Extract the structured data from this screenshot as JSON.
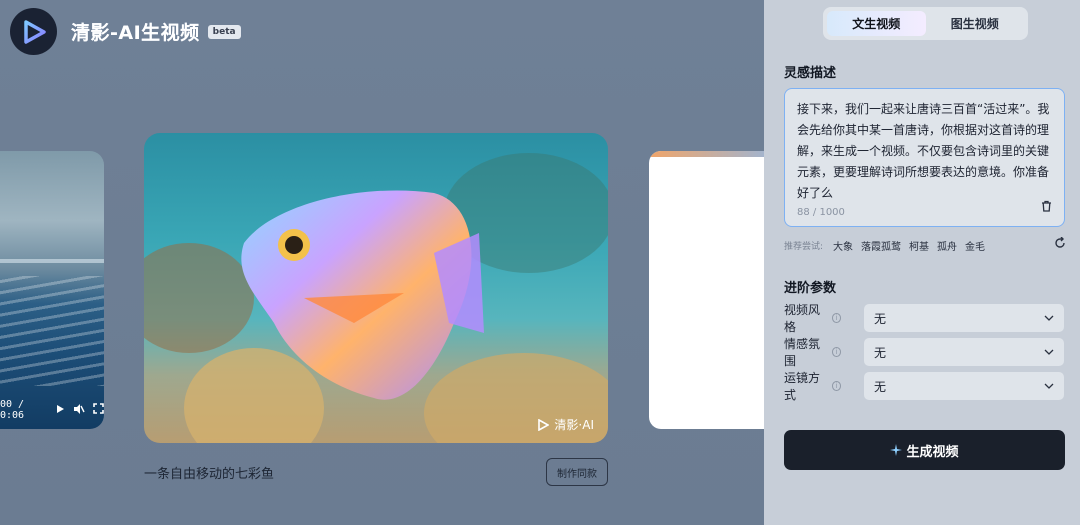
{
  "brand": {
    "name": "清影-AI生视频",
    "badge": "beta"
  },
  "gallery": {
    "left_player": {
      "time": "00 / 0:06"
    },
    "main": {
      "watermark": "清影·AI",
      "caption": "一条自由移动的七彩鱼",
      "make_same_label": "制作同款"
    }
  },
  "panel": {
    "tabs": [
      {
        "label": "文生视频",
        "active": true
      },
      {
        "label": "图生视频",
        "active": false
      }
    ],
    "inspiration_title": "灵感描述",
    "prompt": {
      "text": "接下来，我们一起来让唐诗三百首“活过来”。我会先给你其中某一首唐诗，你根据对这首诗的理解，来生成一个视频。不仅要包含诗词里的关键元素，更要理解诗词所想要表达的意境。你准备好了么",
      "counter": "88 / 1000"
    },
    "suggestions": {
      "label": "推荐尝试:",
      "items": [
        "大象",
        "落霞孤鹜",
        "柯基",
        "孤舟",
        "金毛"
      ]
    },
    "advanced_title": "进阶参数",
    "params": [
      {
        "label": "视频风格",
        "value": "无"
      },
      {
        "label": "情感氛围",
        "value": "无"
      },
      {
        "label": "运镜方式",
        "value": "无"
      }
    ],
    "generate_label": "生成视频"
  },
  "colors": {
    "accent": "#7eb1f3",
    "button": "#1a202b",
    "panel_bg": "#c7ced8"
  }
}
